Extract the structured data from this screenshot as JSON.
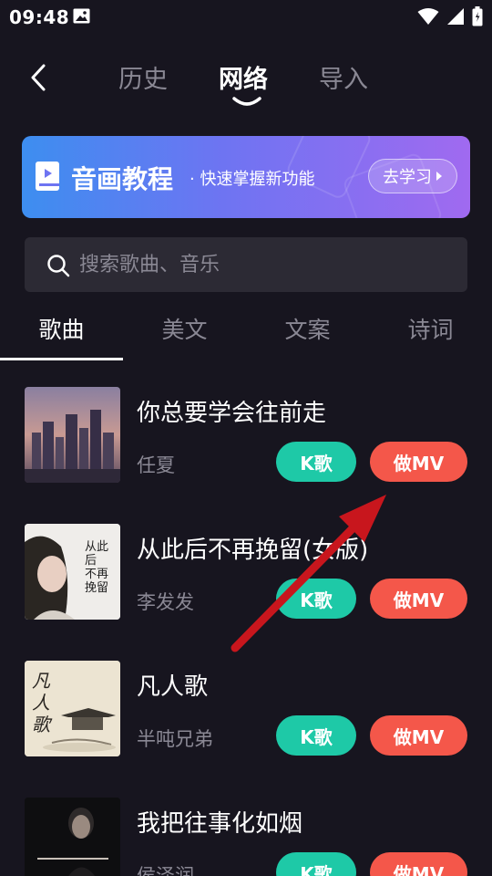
{
  "status_bar": {
    "time": "09:48"
  },
  "top_nav": {
    "tabs": [
      {
        "label": "历史"
      },
      {
        "label": "网络",
        "active": true
      },
      {
        "label": "导入"
      }
    ]
  },
  "banner": {
    "title": "音画教程",
    "subtitle": "· 快速掌握新功能",
    "button_label": "去学习"
  },
  "search": {
    "placeholder": "搜索歌曲、音乐"
  },
  "category_tabs": [
    {
      "label": "歌曲",
      "active": true
    },
    {
      "label": "美文"
    },
    {
      "label": "文案"
    },
    {
      "label": "诗词"
    }
  ],
  "songs": [
    {
      "title": "你总要学会往前走",
      "artist": "任夏",
      "k_label": "K歌",
      "mv_label": "做MV"
    },
    {
      "title": "从此后不再挽留(女版)",
      "artist": "李发发",
      "k_label": "K歌",
      "mv_label": "做MV",
      "cover_text": "从此后 不再挽留"
    },
    {
      "title": "凡人歌",
      "artist": "半吨兄弟",
      "k_label": "K歌",
      "mv_label": "做MV",
      "cover_text": "凡人歌"
    },
    {
      "title": "我把往事化如烟",
      "artist": "侯泽润",
      "k_label": "K歌",
      "mv_label": "做MV"
    }
  ],
  "colors": {
    "background": "#17151f",
    "k_button": "#1ec9a7",
    "mv_button": "#f4574a",
    "secondary_text": "#8a8894",
    "annotation_arrow": "#c8161d"
  }
}
